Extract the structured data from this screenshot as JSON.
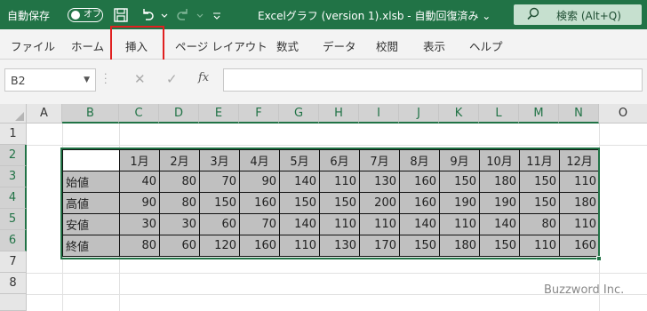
{
  "titlebar": {
    "autosave_label": "自動保存",
    "autosave_state": "オフ",
    "filename": "Excelグラフ (version 1).xlsb  -  自動回復済み ⌄",
    "search_label": "検索 (Alt+Q)"
  },
  "ribbon": {
    "tabs": [
      "ファイル",
      "ホーム",
      "挿入",
      "ページ レイアウト",
      "数式",
      "データ",
      "校閲",
      "表示",
      "ヘルプ"
    ],
    "highlighted_tab": "挿入"
  },
  "formula_bar": {
    "name_box": "B2",
    "fx_label": "fx",
    "formula": ""
  },
  "sheet": {
    "columns": [
      "A",
      "B",
      "C",
      "D",
      "E",
      "F",
      "G",
      "H",
      "I",
      "J",
      "K",
      "L",
      "M",
      "N",
      "O"
    ],
    "rows": [
      "1",
      "2",
      "3",
      "4",
      "5",
      "6",
      "7",
      "8"
    ],
    "selected_columns": [
      "B",
      "C",
      "D",
      "E",
      "F",
      "G",
      "H",
      "I",
      "J",
      "K",
      "L",
      "M",
      "N"
    ],
    "selected_rows": [
      "2",
      "3",
      "4",
      "5",
      "6"
    ]
  },
  "table": {
    "headers": [
      "",
      "1月",
      "2月",
      "3月",
      "4月",
      "5月",
      "6月",
      "7月",
      "8月",
      "9月",
      "10月",
      "11月",
      "12月"
    ],
    "rows": [
      {
        "label": "始値",
        "values": [
          "40",
          "80",
          "70",
          "90",
          "140",
          "110",
          "130",
          "160",
          "150",
          "180",
          "150",
          "110"
        ]
      },
      {
        "label": "高値",
        "values": [
          "90",
          "80",
          "150",
          "160",
          "150",
          "150",
          "200",
          "160",
          "190",
          "190",
          "150",
          "180"
        ]
      },
      {
        "label": "安値",
        "values": [
          "30",
          "30",
          "60",
          "70",
          "140",
          "110",
          "110",
          "140",
          "110",
          "140",
          "80",
          "110"
        ]
      },
      {
        "label": "終値",
        "values": [
          "80",
          "60",
          "120",
          "160",
          "110",
          "130",
          "170",
          "150",
          "180",
          "150",
          "110",
          "160"
        ]
      }
    ]
  },
  "watermark": "Buzzword Inc.",
  "colors": {
    "brand": "#217346",
    "highlight": "#e02020"
  }
}
